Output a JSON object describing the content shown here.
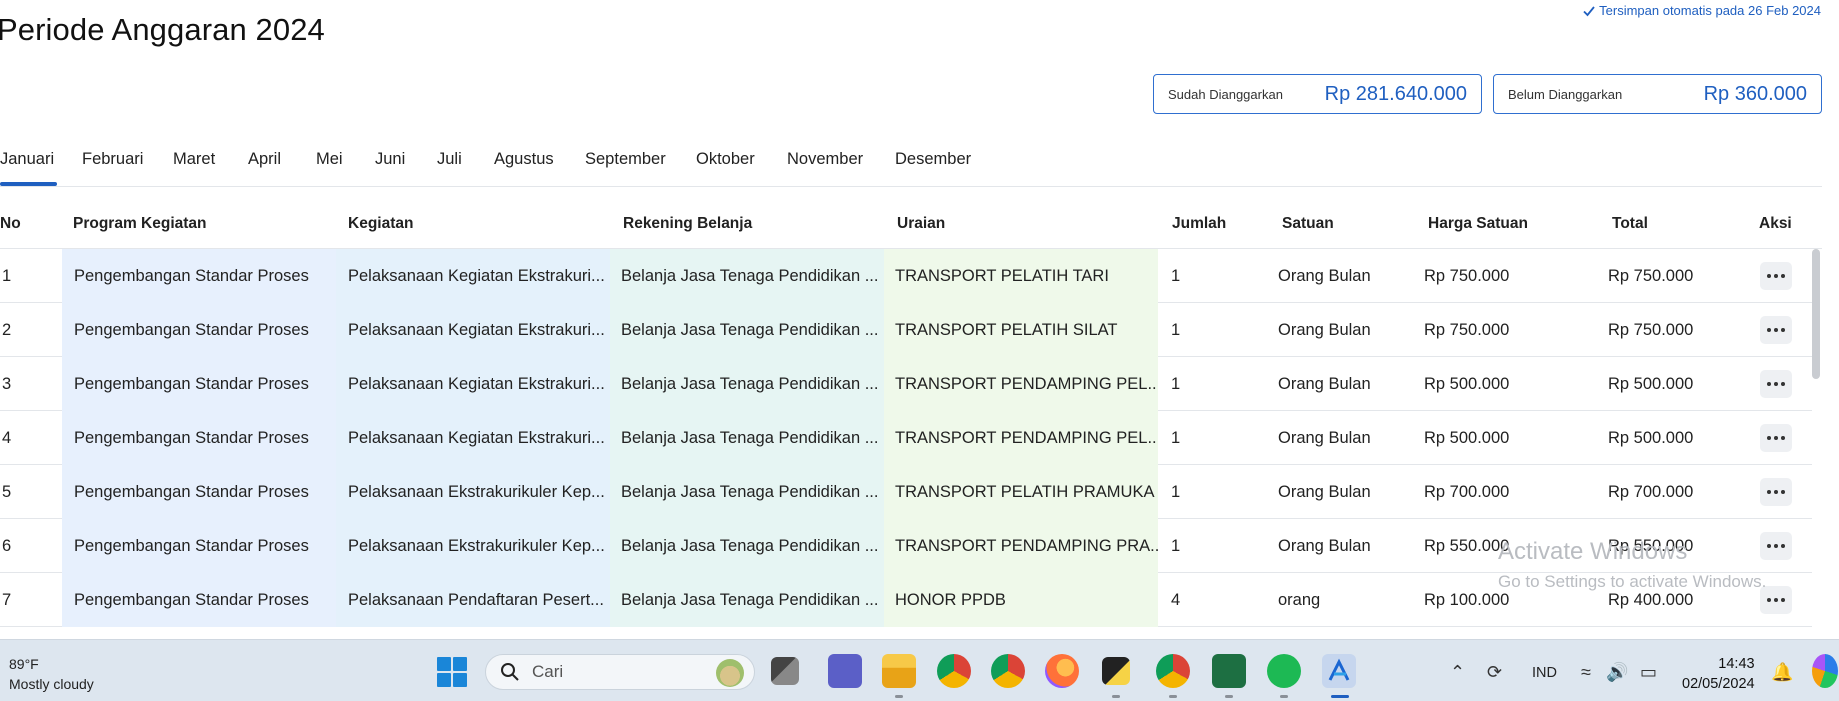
{
  "page": {
    "title": "Periode Anggaran 2024",
    "autosave": "Tersimpan otomatis pada 26 Feb 2024"
  },
  "summary": {
    "budgeted": {
      "label": "Sudah Dianggarkan",
      "value": "Rp 281.640.000"
    },
    "unbudgeted": {
      "label": "Belum Dianggarkan",
      "value": "Rp 360.000"
    }
  },
  "months": [
    "Januari",
    "Februari",
    "Maret",
    "April",
    "Mei",
    "Juni",
    "Juli",
    "Agustus",
    "September",
    "Oktober",
    "November",
    "Desember"
  ],
  "active_month": "Januari",
  "table": {
    "headers": {
      "no": "No",
      "program": "Program Kegiatan",
      "kegiatan": "Kegiatan",
      "rekening": "Rekening Belanja",
      "uraian": "Uraian",
      "jumlah": "Jumlah",
      "satuan": "Satuan",
      "harga": "Harga Satuan",
      "total": "Total",
      "aksi": "Aksi"
    },
    "rows": [
      {
        "no": "1",
        "program": "Pengembangan Standar Proses",
        "kegiatan": "Pelaksanaan Kegiatan Ekstrakuri...",
        "rekening": "Belanja Jasa Tenaga Pendidikan ...",
        "uraian": "TRANSPORT PELATIH TARI",
        "jumlah": "1",
        "satuan": "Orang Bulan",
        "harga": "Rp 750.000",
        "total": "Rp 750.000"
      },
      {
        "no": "2",
        "program": "Pengembangan Standar Proses",
        "kegiatan": "Pelaksanaan Kegiatan Ekstrakuri...",
        "rekening": "Belanja Jasa Tenaga Pendidikan ...",
        "uraian": "TRANSPORT PELATIH SILAT",
        "jumlah": "1",
        "satuan": "Orang Bulan",
        "harga": "Rp 750.000",
        "total": "Rp 750.000"
      },
      {
        "no": "3",
        "program": "Pengembangan Standar Proses",
        "kegiatan": "Pelaksanaan Kegiatan Ekstrakuri...",
        "rekening": "Belanja Jasa Tenaga Pendidikan ...",
        "uraian": "TRANSPORT PENDAMPING PEL...",
        "jumlah": "1",
        "satuan": "Orang Bulan",
        "harga": "Rp 500.000",
        "total": "Rp 500.000"
      },
      {
        "no": "4",
        "program": "Pengembangan Standar Proses",
        "kegiatan": "Pelaksanaan Kegiatan Ekstrakuri...",
        "rekening": "Belanja Jasa Tenaga Pendidikan ...",
        "uraian": "TRANSPORT PENDAMPING PEL...",
        "jumlah": "1",
        "satuan": "Orang Bulan",
        "harga": "Rp 500.000",
        "total": "Rp 500.000"
      },
      {
        "no": "5",
        "program": "Pengembangan Standar Proses",
        "kegiatan": "Pelaksanaan Ekstrakurikuler Kep...",
        "rekening": "Belanja Jasa Tenaga Pendidikan ...",
        "uraian": "TRANSPORT PELATIH PRAMUKA",
        "jumlah": "1",
        "satuan": "Orang Bulan",
        "harga": "Rp 700.000",
        "total": "Rp 700.000"
      },
      {
        "no": "6",
        "program": "Pengembangan Standar Proses",
        "kegiatan": "Pelaksanaan Ekstrakurikuler Kep...",
        "rekening": "Belanja Jasa Tenaga Pendidikan ...",
        "uraian": "TRANSPORT PENDAMPING PRA...",
        "jumlah": "1",
        "satuan": "Orang Bulan",
        "harga": "Rp 550.000",
        "total": "Rp 550.000"
      },
      {
        "no": "7",
        "program": "Pengembangan Standar Proses",
        "kegiatan": "Pelaksanaan Pendaftaran Pesert...",
        "rekening": "Belanja Jasa Tenaga Pendidikan ...",
        "uraian": "HONOR PPDB",
        "jumlah": "4",
        "satuan": "orang",
        "harga": "Rp 100.000",
        "total": "Rp 400.000"
      }
    ]
  },
  "watermark": {
    "line1": "Activate Windows",
    "line2": "Go to Settings to activate Windows."
  },
  "taskbar": {
    "weather_temp": "89°F",
    "weather_desc": "Mostly cloudy",
    "search_placeholder": "Cari",
    "apps": [
      "task-view-icon",
      "teams-icon",
      "file-explorer-icon",
      "chrome-icon",
      "chrome-profile-icon",
      "firefox-icon",
      "sticky-notes-icon",
      "chrome-user-icon",
      "excel-icon",
      "spotify-icon",
      "app-active-icon"
    ],
    "language": "IND",
    "time": "14:43",
    "date": "02/05/2024"
  },
  "colors": {
    "accent": "#1f5fc0",
    "program_col": "#e7f0fd",
    "kegiatan_col": "#e4f1fb",
    "rekening_col": "#e6f5f3",
    "uraian_col": "#eff9ea"
  }
}
